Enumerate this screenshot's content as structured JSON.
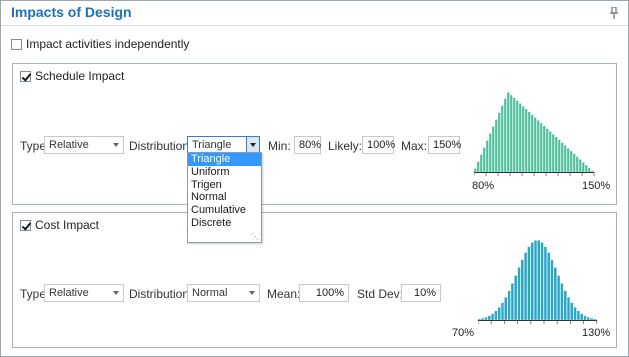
{
  "title": "Impacts of Design",
  "colors": {
    "schedule_bar": "#4dbf9a",
    "cost_bar": "#2aa6c6",
    "accent": "#1d6fb8"
  },
  "independent": {
    "label": "Impact activities independently",
    "checked": false
  },
  "schedule": {
    "label": "Schedule Impact",
    "checked": true,
    "type_label": "Type:",
    "type_value": "Relative",
    "dist_label": "Distribution:",
    "dist_value": "Triangle",
    "min_label": "Min:",
    "min_value": "80%",
    "likely_label": "Likely:",
    "likely_value": "100%",
    "max_label": "Max:",
    "max_value": "150%",
    "axis_min": "80%",
    "axis_max": "150%",
    "dropdown_options": [
      "Triangle",
      "Uniform",
      "Trigen",
      "Normal",
      "Cumulative",
      "Discrete"
    ],
    "dropdown_selected": "Triangle"
  },
  "cost": {
    "label": "Cost Impact",
    "checked": true,
    "type_label": "Type:",
    "type_value": "Relative",
    "dist_label": "Distribution:",
    "dist_value": "Normal",
    "mean_label": "Mean:",
    "mean_value": "100%",
    "std_label": "Std Dev:",
    "std_value": "10%",
    "axis_min": "70%",
    "axis_max": "130%"
  },
  "chart_data": [
    {
      "type": "bar",
      "distribution": "triangle",
      "x_range": [
        "80%",
        "150%"
      ],
      "min": 80,
      "mode": 100,
      "max": 150,
      "grid": false
    },
    {
      "type": "bar",
      "distribution": "normal",
      "x_range": [
        "70%",
        "130%"
      ],
      "mean": 100,
      "std_dev": 10,
      "grid": false
    }
  ]
}
